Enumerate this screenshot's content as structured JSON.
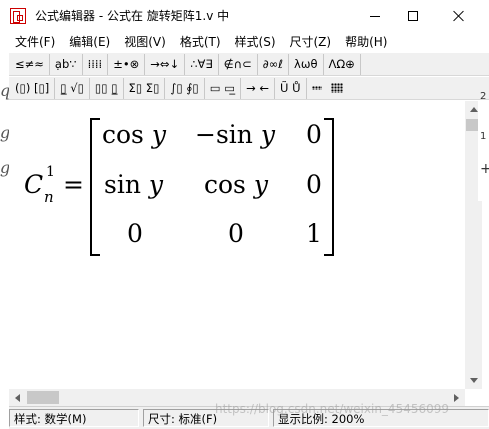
{
  "window": {
    "title": "公式编辑器 - 公式在 旋转矩阵1.v 中"
  },
  "menubar": {
    "items": [
      "文件(F)",
      "编辑(E)",
      "视图(V)",
      "格式(T)",
      "样式(S)",
      "尺寸(Z)",
      "帮助(H)"
    ]
  },
  "toolbar_row1": {
    "buttons": [
      "≤≠≈",
      "ạb∵",
      "⁞⁞⁞⁞",
      "±•⊗",
      "→⇔↓",
      "∴∀∃",
      "∉∩⊂",
      "∂∞ℓ",
      "λωθ",
      "ΛΩ⊕"
    ]
  },
  "toolbar_row2": {
    "buttons": [
      "(▯) [▯]",
      "▯̲ √▯",
      "▯▯ ▯̲",
      "Σ▯ Σ▯",
      "∫▯ ∮▯",
      "▭ ▭̲",
      "→ ←",
      "Ũ Ů"
    ]
  },
  "equation": {
    "lhs_symbol": "C",
    "lhs_superscript": "1",
    "lhs_subscript": "n",
    "equals": "=",
    "matrix": {
      "row1": {
        "c1_fn": "cos",
        "c1_var": "y",
        "c2_fn": "−sin",
        "c2_var": "y",
        "c3": "0"
      },
      "row2": {
        "c1_fn": "sin",
        "c1_var": "y",
        "c2_fn": "cos",
        "c2_var": "y",
        "c3": "0"
      },
      "row3": {
        "c1": "0",
        "c2": "0",
        "c3": "1"
      }
    }
  },
  "left_edge": [
    "q",
    "g",
    "g"
  ],
  "ruler_right": [
    "2",
    "1",
    "+"
  ],
  "statusbar": {
    "style": "样式: 数学(M)",
    "size": "尺寸: 标准(F)",
    "zoom": "显示比例: 200%"
  },
  "watermark": "https://blog.csdn.net/weixin_45456099"
}
